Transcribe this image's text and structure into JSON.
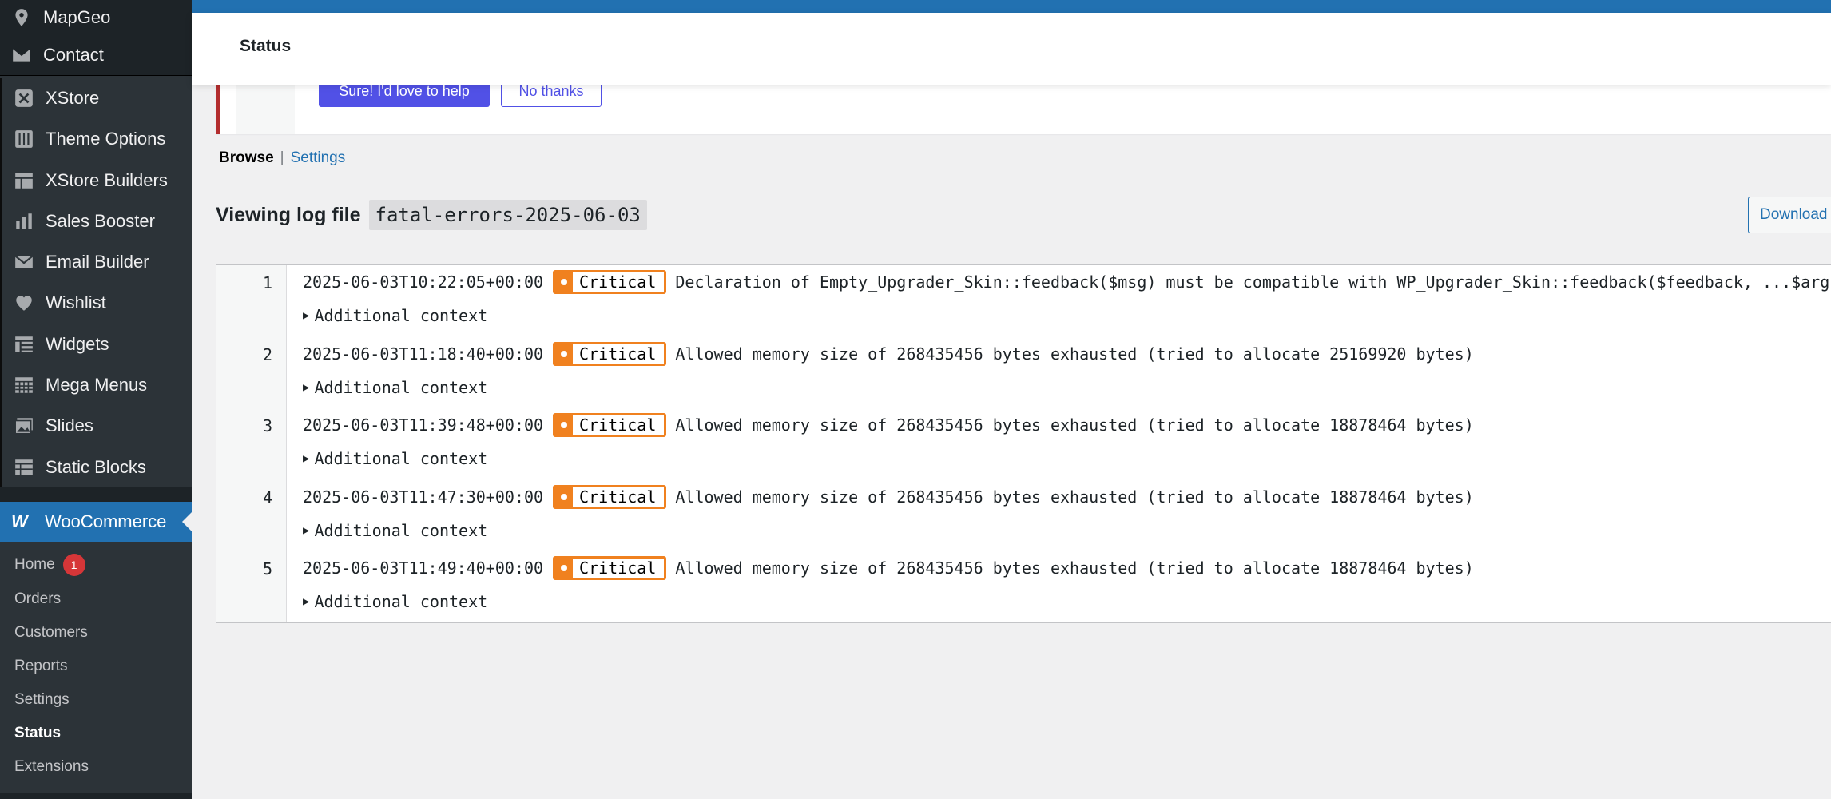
{
  "sidebar": {
    "top_items": [
      {
        "label": "MapGeo",
        "icon": "map-pin-icon"
      },
      {
        "label": "Contact",
        "icon": "envelope-icon"
      }
    ],
    "xstore_items": [
      {
        "label": "XStore",
        "icon": "xstore-logo-icon"
      },
      {
        "label": "Theme Options",
        "icon": "sliders-icon"
      },
      {
        "label": "XStore Builders",
        "icon": "layout-grid-icon"
      },
      {
        "label": "Sales Booster",
        "icon": "bar-chart-icon"
      },
      {
        "label": "Email Builder",
        "icon": "envelope-icon"
      },
      {
        "label": "Wishlist",
        "icon": "heart-icon"
      },
      {
        "label": "Widgets",
        "icon": "widgets-icon"
      },
      {
        "label": "Mega Menus",
        "icon": "calendar-grid-icon"
      },
      {
        "label": "Slides",
        "icon": "slides-icon"
      },
      {
        "label": "Static Blocks",
        "icon": "blocks-icon"
      }
    ],
    "woocommerce": {
      "label": "WooCommerce",
      "submenu": [
        {
          "label": "Home",
          "badge": "1"
        },
        {
          "label": "Orders"
        },
        {
          "label": "Customers"
        },
        {
          "label": "Reports"
        },
        {
          "label": "Settings"
        },
        {
          "label": "Status"
        },
        {
          "label": "Extensions"
        }
      ]
    }
  },
  "header": {
    "title": "Status"
  },
  "notice": {
    "primary_label": "Sure! I'd love to help",
    "secondary_label": "No thanks"
  },
  "nav": {
    "browse": "Browse",
    "separator": "|",
    "settings": "Settings"
  },
  "log": {
    "heading": "Viewing log file",
    "filename": "fatal-errors-2025-06-03",
    "download_label": "Download",
    "context_label": "Additional context",
    "rows": [
      {
        "line": "1",
        "timestamp": "2025-06-03T10:22:05+00:00",
        "level": "Critical",
        "message": "Declaration of Empty_Upgrader_Skin::feedback($msg) must be compatible with WP_Upgrader_Skin::feedback($feedback, ...$args)"
      },
      {
        "line": "2",
        "timestamp": "2025-06-03T11:18:40+00:00",
        "level": "Critical",
        "message": "Allowed memory size of 268435456 bytes exhausted (tried to allocate 25169920 bytes)"
      },
      {
        "line": "3",
        "timestamp": "2025-06-03T11:39:48+00:00",
        "level": "Critical",
        "message": "Allowed memory size of 268435456 bytes exhausted (tried to allocate 18878464 bytes)"
      },
      {
        "line": "4",
        "timestamp": "2025-06-03T11:47:30+00:00",
        "level": "Critical",
        "message": "Allowed memory size of 268435456 bytes exhausted (tried to allocate 18878464 bytes)"
      },
      {
        "line": "5",
        "timestamp": "2025-06-03T11:49:40+00:00",
        "level": "Critical",
        "message": "Allowed memory size of 268435456 bytes exhausted (tried to allocate 18878464 bytes)"
      }
    ]
  },
  "colors": {
    "admin_blue": "#2271b1",
    "sidebar_bg": "#1d2327",
    "critical_orange": "#f0811f",
    "badge_red": "#d63638",
    "notice_button": "#5151e6"
  }
}
